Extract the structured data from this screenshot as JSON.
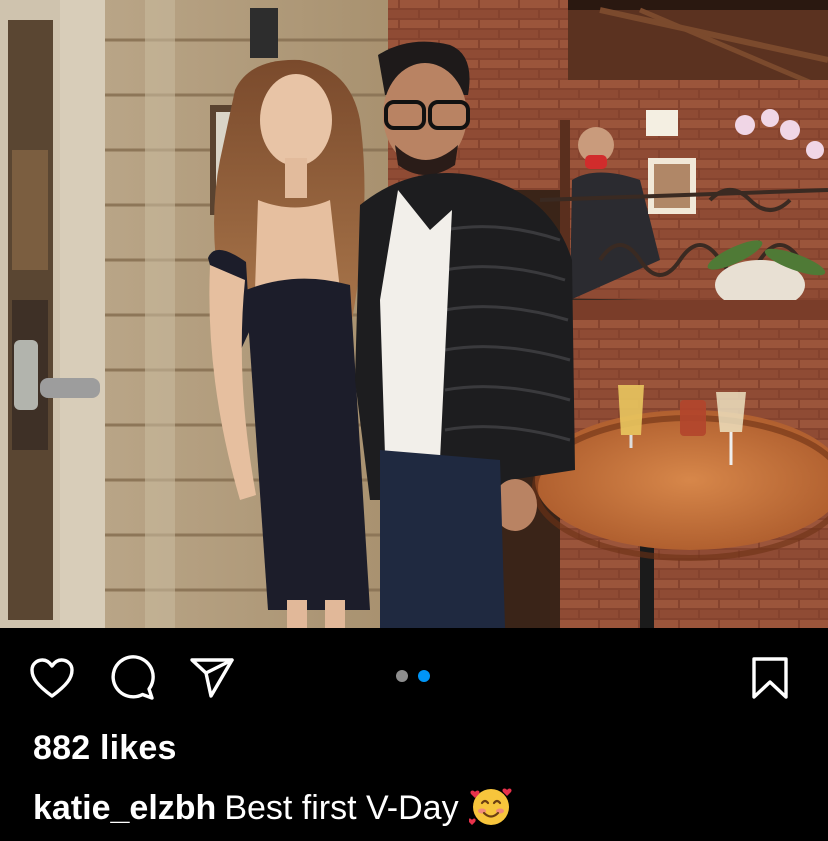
{
  "post": {
    "image_alt": "Photo of a couple standing in a restaurant",
    "carousel": {
      "count": 2,
      "active_index": 1
    },
    "likes_text": "882 likes",
    "caption": {
      "username": "katie_elzbh",
      "text": "Best first V-Day"
    }
  },
  "icons": {
    "like": "heart-icon",
    "comment": "comment-bubble-icon",
    "share": "paper-plane-icon",
    "save": "bookmark-icon",
    "caption_emoji": "smiling-face-with-hearts-emoji"
  },
  "colors": {
    "background": "#000000",
    "text": "#ffffff",
    "carousel_active": "#0095f6",
    "carousel_inactive": "#8e8e8e"
  }
}
